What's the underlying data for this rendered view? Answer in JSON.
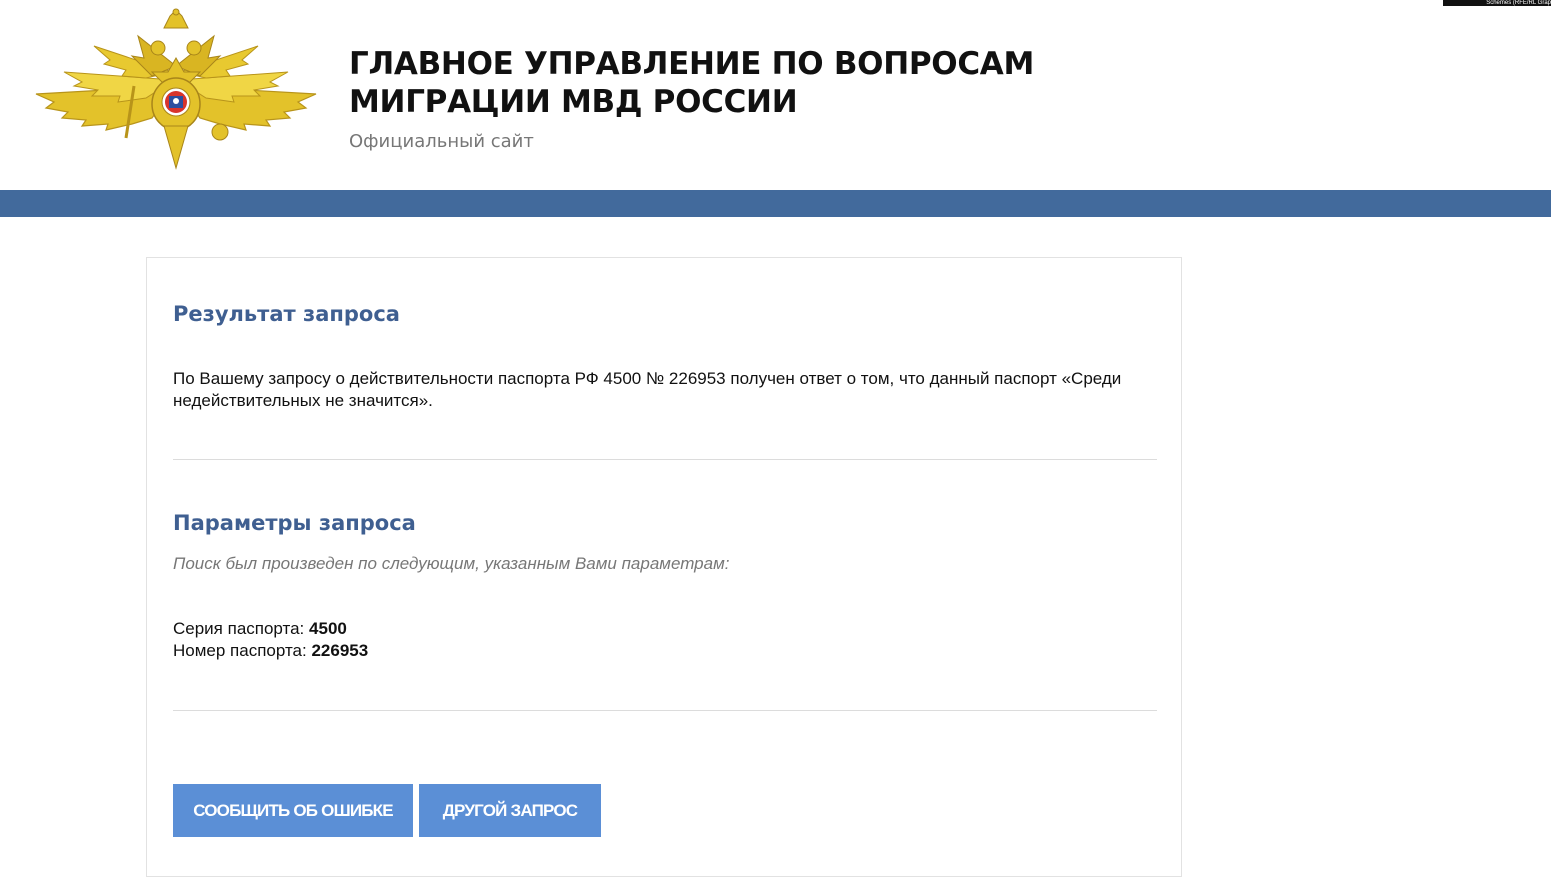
{
  "header": {
    "title_line1": "ГЛАВНОЕ УПРАВЛЕНИЕ ПО ВОПРОСАМ",
    "title_line2": "МИГРАЦИИ МВД РОССИИ",
    "subtitle": "Официальный сайт",
    "watermark": "Schemes (RFE/RL Grap"
  },
  "colors": {
    "header_bar": "#426a9c",
    "heading": "#3f5f91",
    "button": "#5b8fd6",
    "emblem_gold": "#e3c22a"
  },
  "result": {
    "heading": "Результат запроса",
    "text": "По Вашему запросу о действительности паспорта РФ 4500 № 226953 получен ответ о том, что данный паспорт «Среди недействительных не значится»."
  },
  "params": {
    "heading": "Параметры запроса",
    "note": "Поиск был произведен по следующим, указанным Вами параметрам:",
    "series_label": "Серия паспорта:",
    "series_value": "4500",
    "number_label": "Номер паспорта:",
    "number_value": "226953"
  },
  "buttons": {
    "report_error": "СООБЩИТЬ ОБ ОШИБКЕ",
    "other_request": "ДРУГОЙ ЗАПРОС"
  },
  "icons": {
    "emblem": "mvd-double-headed-eagle-emblem-icon"
  }
}
